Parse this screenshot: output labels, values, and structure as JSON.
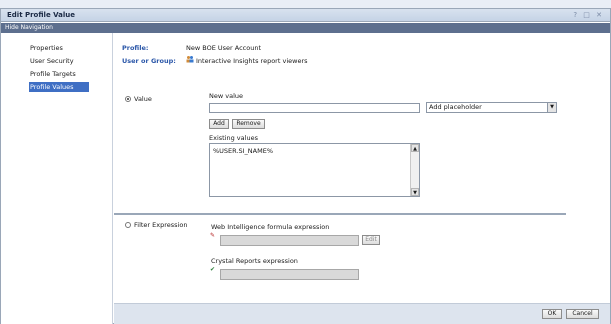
{
  "window": {
    "title": "Edit Profile Value",
    "controls": "? □ ✕"
  },
  "nav": {
    "hide_label": "Hide Navigation",
    "items": [
      {
        "label": "Properties",
        "active": false
      },
      {
        "label": "User Security",
        "active": false
      },
      {
        "label": "Profile Targets",
        "active": false
      },
      {
        "label": "Profile Values",
        "active": true
      }
    ]
  },
  "profile": {
    "profile_label": "Profile:",
    "profile_value": "New BOE User Account",
    "group_label": "User or Group:",
    "group_value": "Interactive Insights report viewers",
    "group_icon": "user-group-icon"
  },
  "value_section": {
    "radio_label": "Value",
    "new_value_label": "New value",
    "new_value_input": "",
    "placeholder_select": "Add placeholder",
    "add_button": "Add",
    "remove_button": "Remove",
    "existing_label": "Existing values",
    "existing_values": [
      "%USER.SI_NAME%"
    ]
  },
  "filter_section": {
    "radio_label": "Filter Expression",
    "webi_label": "Web Intelligence formula expression",
    "edit_button": "Edit",
    "crystal_label": "Crystal Reports expression"
  },
  "footer": {
    "ok": "OK",
    "cancel": "Cancel"
  }
}
